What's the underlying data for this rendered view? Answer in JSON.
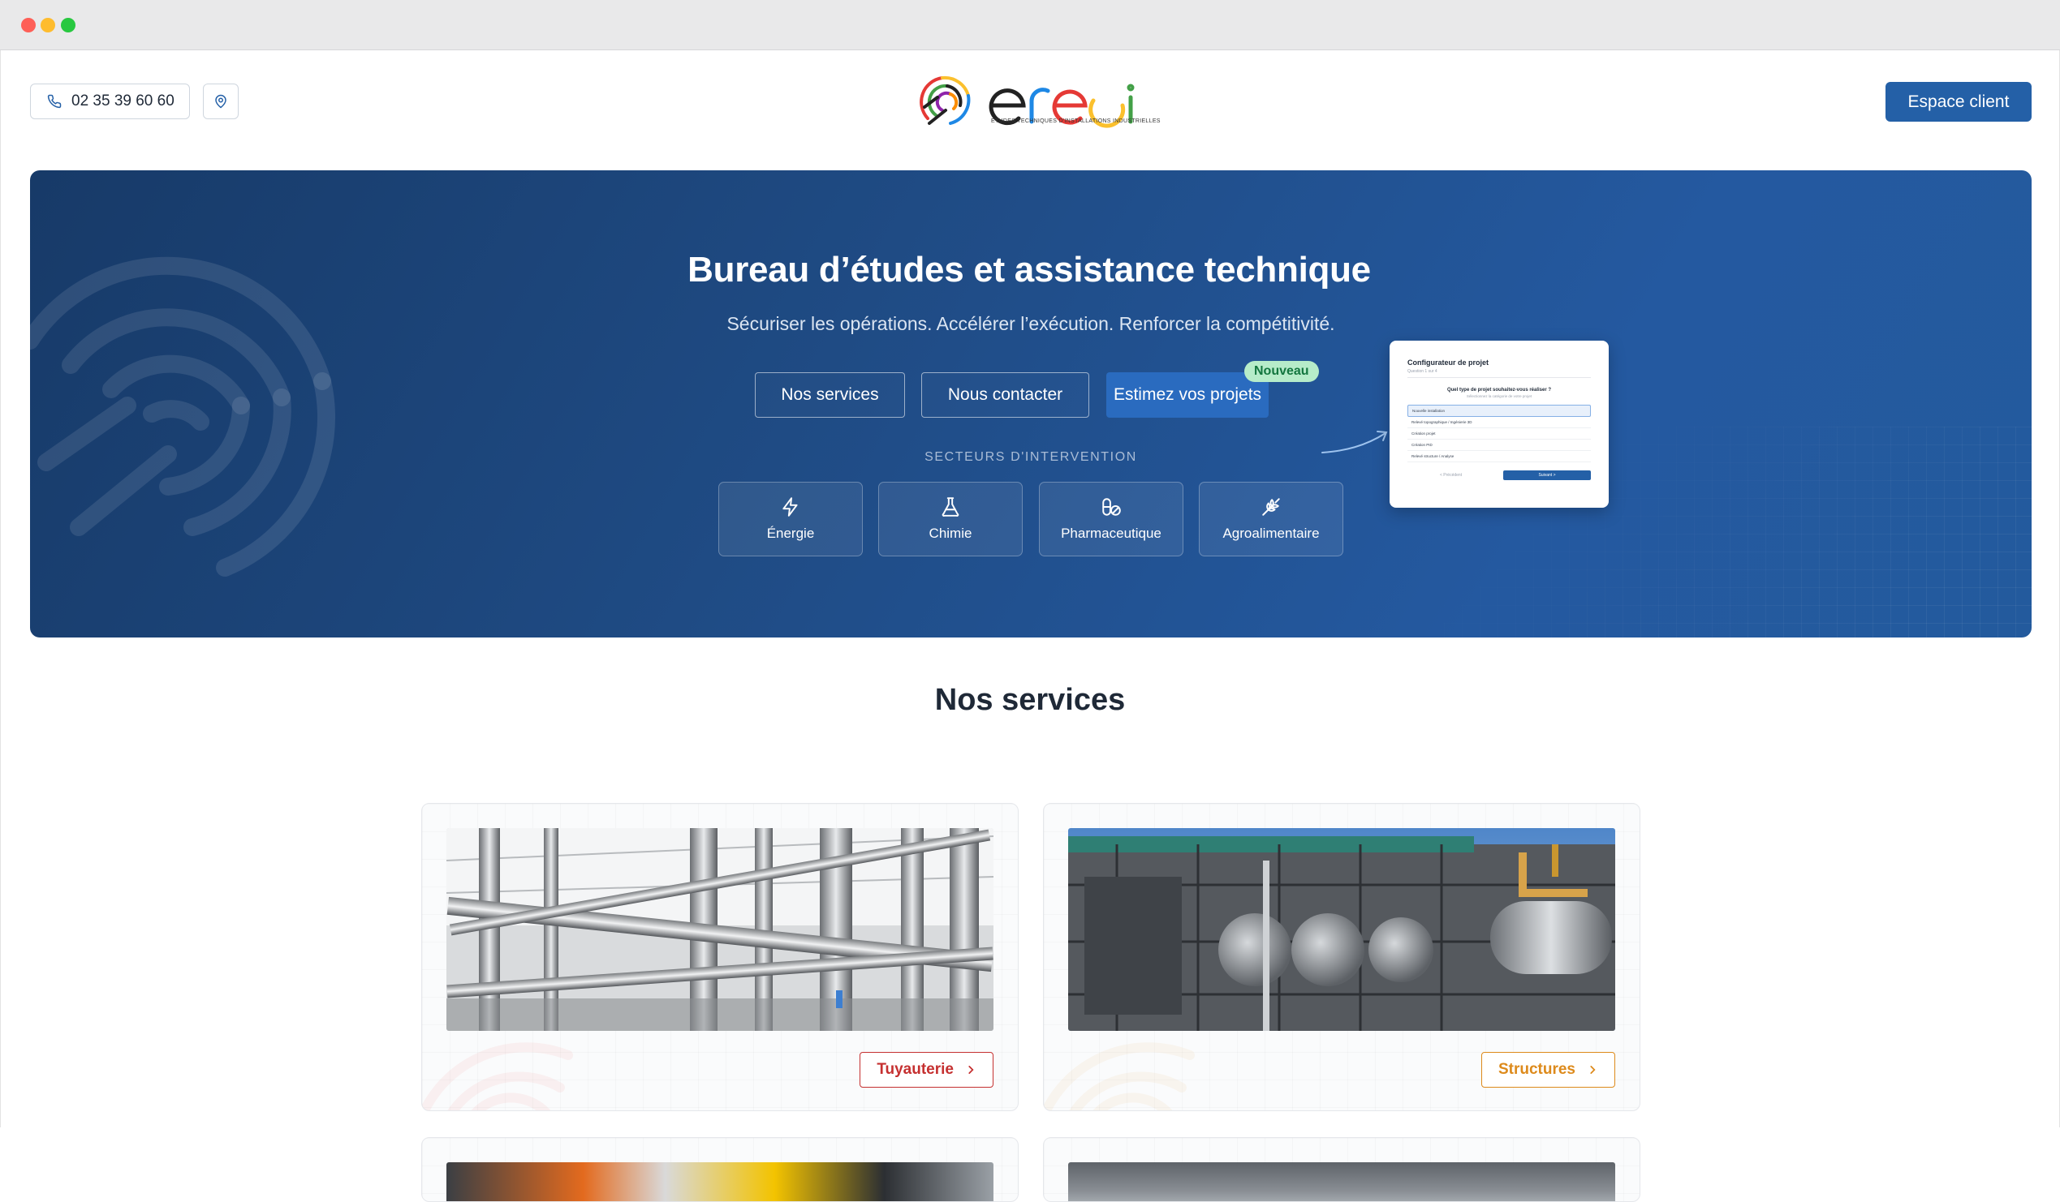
{
  "header": {
    "phone": "02 35 39 60 60",
    "logo_tagline": "ÉTUDES TECHNIQUES D'INSTALLATIONS INDUSTRIELLES",
    "client_button": "Espace client"
  },
  "hero": {
    "title": "Bureau d’études et assistance technique",
    "subtitle": "Sécuriser les opérations. Accélérer l’exécution. Renforcer la compétitivité.",
    "buttons": {
      "services": "Nos services",
      "contact": "Nous contacter",
      "estimate": "Estimez vos projets",
      "badge": "Nouveau"
    },
    "configurator": {
      "title": "Configurateur de projet",
      "step": "Question 1 sur 4",
      "question": "Quel type de projet souhaitez-vous réaliser ?",
      "question_sub": "Sélectionnez la catégorie de votre projet",
      "options": [
        "Nouvelle installation",
        "Relevé topographique / Ingénierie 3D",
        "Création projet",
        "Création PID",
        "Relevé structure / Analyse"
      ],
      "prev": "< Précédent",
      "next": "Suivant >"
    },
    "sectors_label": "SECTEURS D'INTERVENTION",
    "sectors": [
      {
        "label": "Énergie",
        "icon": "bolt-icon"
      },
      {
        "label": "Chimie",
        "icon": "flask-icon"
      },
      {
        "label": "Pharmaceutique",
        "icon": "pill-icon"
      },
      {
        "label": "Agroalimentaire",
        "icon": "wheat-icon"
      }
    ]
  },
  "services": {
    "title": "Nos services",
    "cards": [
      {
        "label": "Tuyauterie",
        "color": "#c53030"
      },
      {
        "label": "Structures",
        "color": "#dd8a1b"
      }
    ]
  },
  "colors": {
    "brand_blue": "#2460a7",
    "hero_dark": "#173a68",
    "badge_green": "#b6ecc9"
  }
}
